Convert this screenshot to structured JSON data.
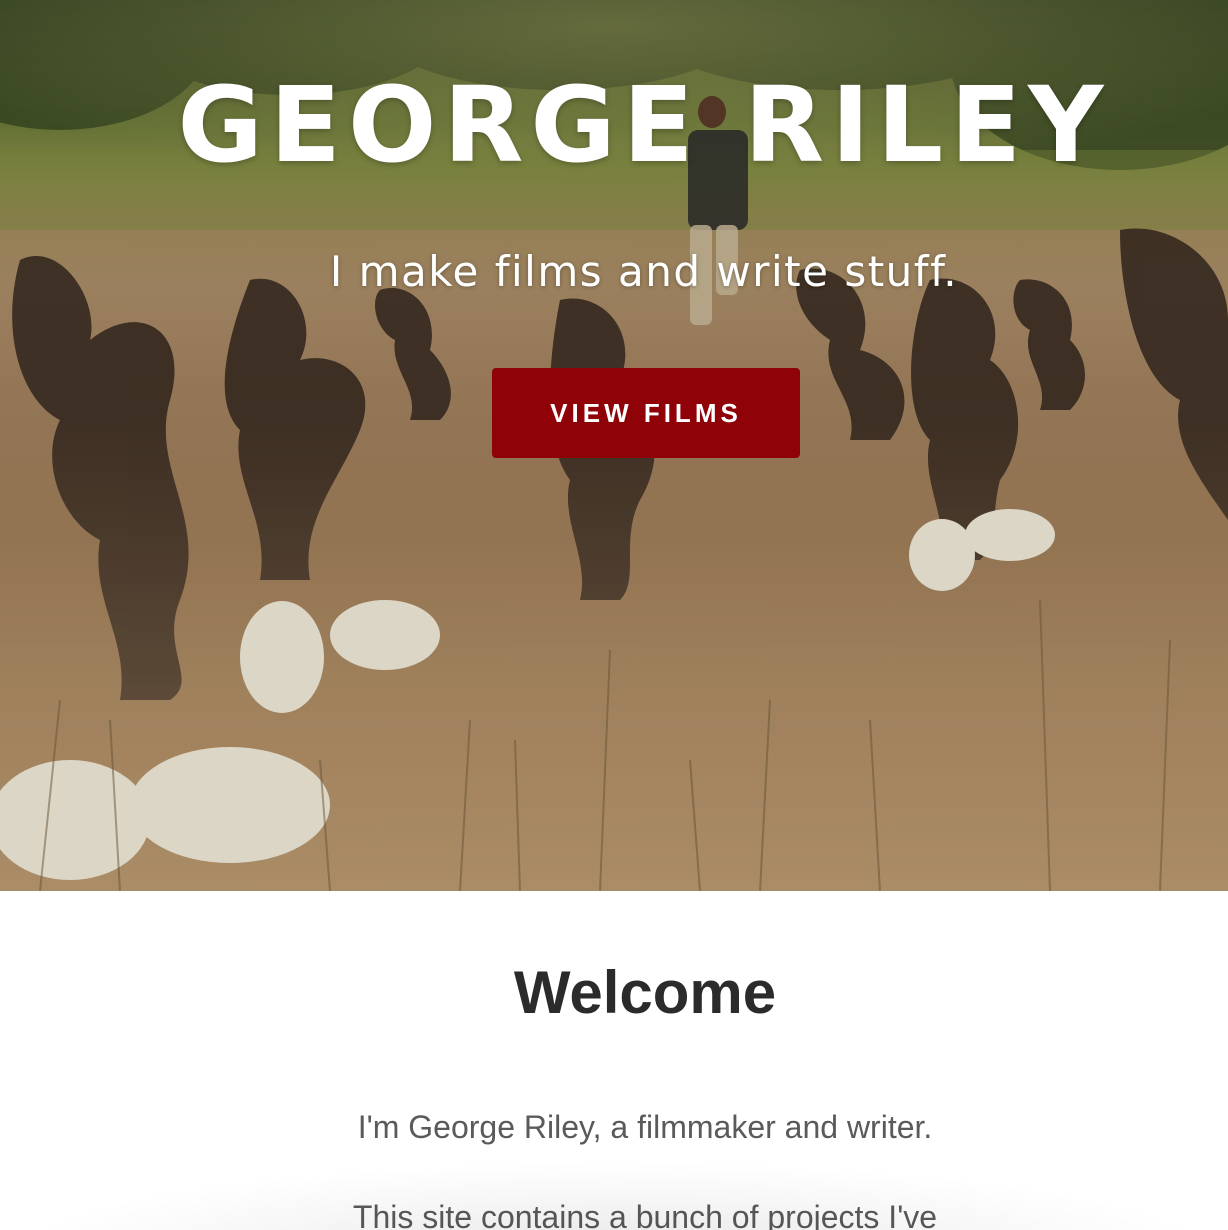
{
  "hero": {
    "title": "GEORGE RILEY",
    "tagline": "I make films and write stuff.",
    "button_label": "VIEW FILMS"
  },
  "welcome": {
    "heading": "Welcome",
    "intro": "I'm George Riley, a filmmaker and writer.",
    "more": "This site contains a bunch of projects I've"
  },
  "colors": {
    "button": "#8f0208",
    "heading_text": "#2b2b2b",
    "body_text": "#5a5a5a"
  }
}
